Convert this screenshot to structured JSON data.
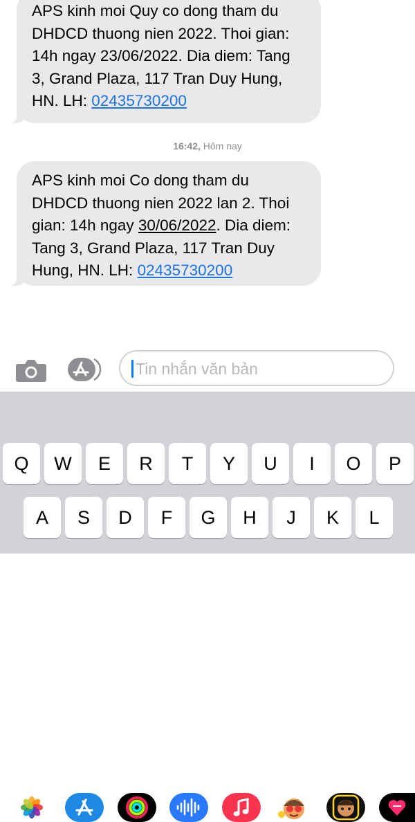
{
  "messages": [
    {
      "text_before": "APS kinh moi Quy co dong tham du DHDCD thuong nien 2022. Thoi gian: 14h ngay 23/06/2022. Dia diem: Tang 3, Grand Plaza, 117 Tran Duy Hung, HN. LH: ",
      "phone": "02435730200"
    },
    {
      "text_before": "APS kinh moi Co dong tham du DHDCD thuong nien 2022 lan 2. Thoi gian: 14h ngay ",
      "date": "30/06/2022",
      "text_after": ". Dia diem: Tang 3, Grand Plaza, 117 Tran Duy Hung, HN. LH: ",
      "phone": "02435730200"
    }
  ],
  "timestamp": {
    "time": "16:42,",
    "day": "Hôm nay"
  },
  "input": {
    "placeholder": "Tin nhắn văn bản"
  },
  "app_strip": [
    {
      "icon": "photos-icon"
    },
    {
      "icon": "app-store-icon"
    },
    {
      "icon": "activity-icon"
    },
    {
      "icon": "audio-message-icon"
    },
    {
      "icon": "music-icon"
    },
    {
      "icon": "memoji-stickers-icon"
    },
    {
      "icon": "memoji-icon"
    },
    {
      "icon": "digital-touch-icon"
    }
  ],
  "keyboard": {
    "row1": [
      "Q",
      "W",
      "E",
      "R",
      "T",
      "Y",
      "U",
      "I",
      "O",
      "P"
    ],
    "row2": [
      "A",
      "S",
      "D",
      "F",
      "G",
      "H",
      "J",
      "K",
      "L"
    ]
  },
  "colors": {
    "bubble": "#e9e9eb",
    "link": "#1a73e8",
    "keyboard_bg": "#d1d3d9",
    "caret": "#007aff"
  }
}
